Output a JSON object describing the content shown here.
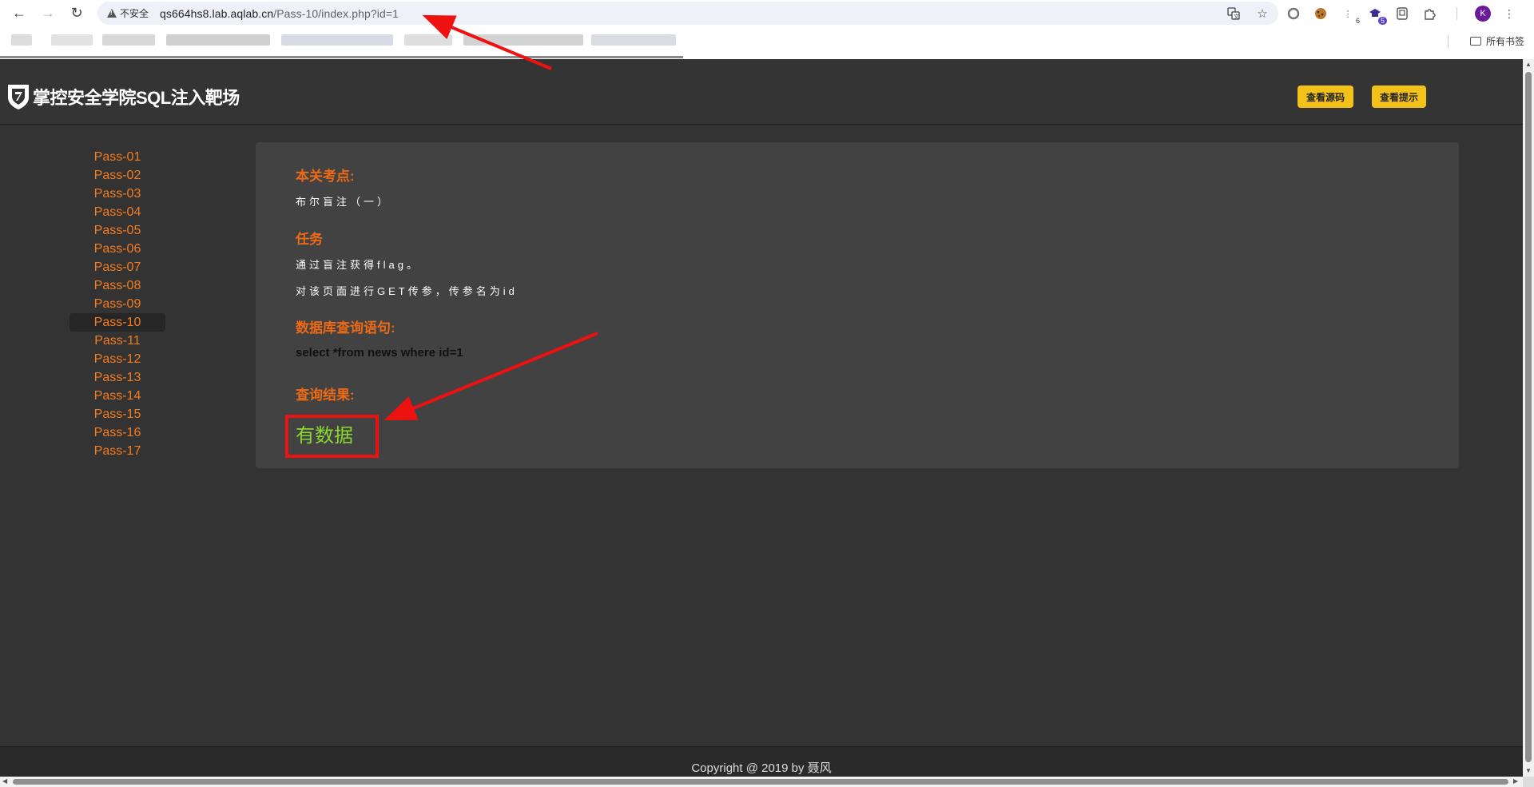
{
  "browser": {
    "security_label": "不安全",
    "url_host": "qs664hs8.lab.aqlab.cn",
    "url_path": "/Pass-10/index.php?id=1",
    "avatar_letter": "K",
    "ext_badge_6": "6",
    "ext_badge_5": "5",
    "all_bookmarks_label": "所有书签"
  },
  "header": {
    "logo_text": "掌控安全学院SQL注入靶场",
    "view_source_label": "查看源码",
    "view_hint_label": "查看提示"
  },
  "sidebar": {
    "active_index": 9,
    "items": [
      {
        "label": "Pass-01"
      },
      {
        "label": "Pass-02"
      },
      {
        "label": "Pass-03"
      },
      {
        "label": "Pass-04"
      },
      {
        "label": "Pass-05"
      },
      {
        "label": "Pass-06"
      },
      {
        "label": "Pass-07"
      },
      {
        "label": "Pass-08"
      },
      {
        "label": "Pass-09"
      },
      {
        "label": "Pass-10"
      },
      {
        "label": "Pass-11"
      },
      {
        "label": "Pass-12"
      },
      {
        "label": "Pass-13"
      },
      {
        "label": "Pass-14"
      },
      {
        "label": "Pass-15"
      },
      {
        "label": "Pass-16"
      },
      {
        "label": "Pass-17"
      }
    ]
  },
  "content": {
    "exam_point_title": "本关考点:",
    "exam_point_text": "布尔盲注（一）",
    "task_title": "任务",
    "task_line1": "通过盲注获得flag。",
    "task_line2": "对该页面进行GET传参，传参名为id",
    "query_title": "数据库查询语句:",
    "query_text": "select *from news where id=1",
    "result_title": "查询结果:",
    "result_text": "有数据"
  },
  "footer": {
    "copyright": "Copyright @ 2019 by 聂风"
  },
  "colors": {
    "accent_orange": "#ec6a14",
    "sidebar_link": "#f57c1f",
    "result_green": "#8bd630",
    "button_yellow": "#f2c21b",
    "annotation_red": "#ee1111",
    "page_bg": "#333333",
    "card_bg": "#424242"
  },
  "icons": [
    "back-arrow-icon",
    "forward-arrow-icon",
    "reload-icon",
    "warning-icon",
    "translate-icon",
    "star-icon",
    "extension-icon",
    "cookie-icon",
    "puzzle-icon",
    "folder-icon",
    "shield-logo-icon"
  ]
}
